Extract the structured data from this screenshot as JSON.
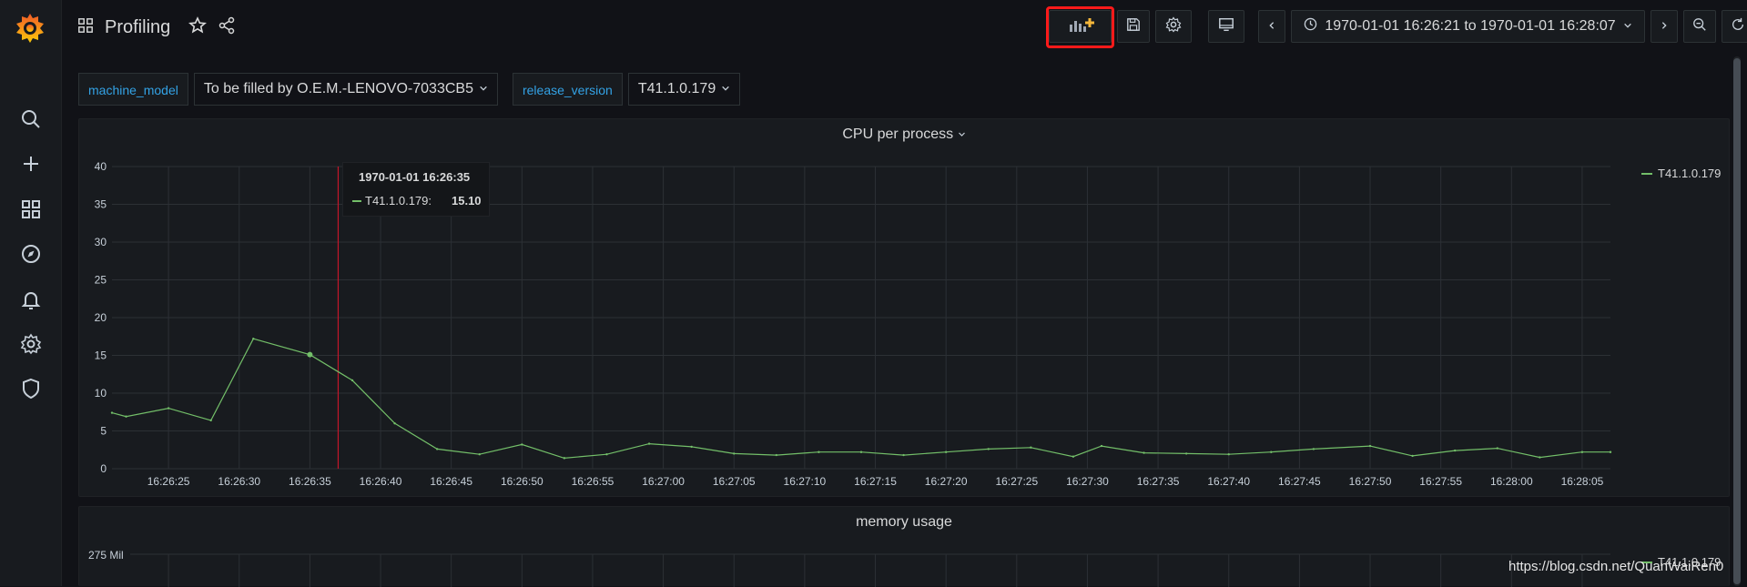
{
  "dashboard": {
    "title": "Profiling"
  },
  "toolbar": {
    "add_panel_icon": "add-panel-icon",
    "time_range": "1970-01-01 16:26:21 to 1970-01-01 16:28:07",
    "highlight_color": "#ff1a1a"
  },
  "variables": [
    {
      "label": "machine_model",
      "value": "To be filled by O.E.M.-LENOVO-7033CB5"
    },
    {
      "label": "release_version",
      "value": "T41.1.0.179"
    }
  ],
  "panels": {
    "cpu": {
      "title": "CPU per process",
      "legend": "T41.1.0.179",
      "tooltip": {
        "time": "1970-01-01 16:26:35",
        "series": "T41.1.0.179:",
        "value": "15.10"
      }
    },
    "memory": {
      "title": "memory usage",
      "y_tick": "275 Mil",
      "legend": "T41.1.0.179"
    }
  },
  "watermark": "https://blog.csdn.net/QuanWaiRen0",
  "chart_data": {
    "type": "line",
    "title": "CPU per process",
    "xlabel": "",
    "ylabel": "",
    "ylim": [
      0,
      40
    ],
    "y_ticks": [
      0,
      5,
      10,
      15,
      20,
      25,
      30,
      35,
      40
    ],
    "x_range": [
      "16:26:21",
      "16:28:07"
    ],
    "x_ticks": [
      "16:26:25",
      "16:26:30",
      "16:26:35",
      "16:26:40",
      "16:26:45",
      "16:26:50",
      "16:26:55",
      "16:27:00",
      "16:27:05",
      "16:27:10",
      "16:27:15",
      "16:27:20",
      "16:27:25",
      "16:27:30",
      "16:27:35",
      "16:27:40",
      "16:27:45",
      "16:27:50",
      "16:27:55",
      "16:28:00",
      "16:28:05"
    ],
    "series": [
      {
        "name": "T41.1.0.179",
        "color": "#73bf69",
        "x": [
          "16:26:21",
          "16:26:22",
          "16:26:25",
          "16:26:28",
          "16:26:31",
          "16:26:35",
          "16:26:38",
          "16:26:41",
          "16:26:44",
          "16:26:47",
          "16:26:50",
          "16:26:53",
          "16:26:56",
          "16:26:59",
          "16:27:02",
          "16:27:05",
          "16:27:08",
          "16:27:11",
          "16:27:14",
          "16:27:17",
          "16:27:20",
          "16:27:23",
          "16:27:26",
          "16:27:29",
          "16:27:31",
          "16:27:34",
          "16:27:37",
          "16:27:40",
          "16:27:43",
          "16:27:46",
          "16:27:50",
          "16:27:53",
          "16:27:56",
          "16:27:59",
          "16:28:02",
          "16:28:05",
          "16:28:07"
        ],
        "values": [
          7.4,
          6.9,
          8.0,
          6.4,
          17.2,
          15.1,
          11.7,
          6.0,
          2.6,
          1.9,
          3.2,
          1.4,
          1.9,
          3.3,
          2.9,
          2.0,
          1.8,
          2.2,
          2.2,
          1.8,
          2.2,
          2.6,
          2.8,
          1.6,
          3.0,
          2.1,
          2.0,
          1.9,
          2.2,
          2.6,
          3.0,
          1.7,
          2.4,
          2.7,
          1.5,
          2.2,
          2.2
        ]
      }
    ],
    "cursor_time": "16:26:37",
    "hover_time": "16:26:35",
    "grid": true,
    "legend_position": "right"
  }
}
